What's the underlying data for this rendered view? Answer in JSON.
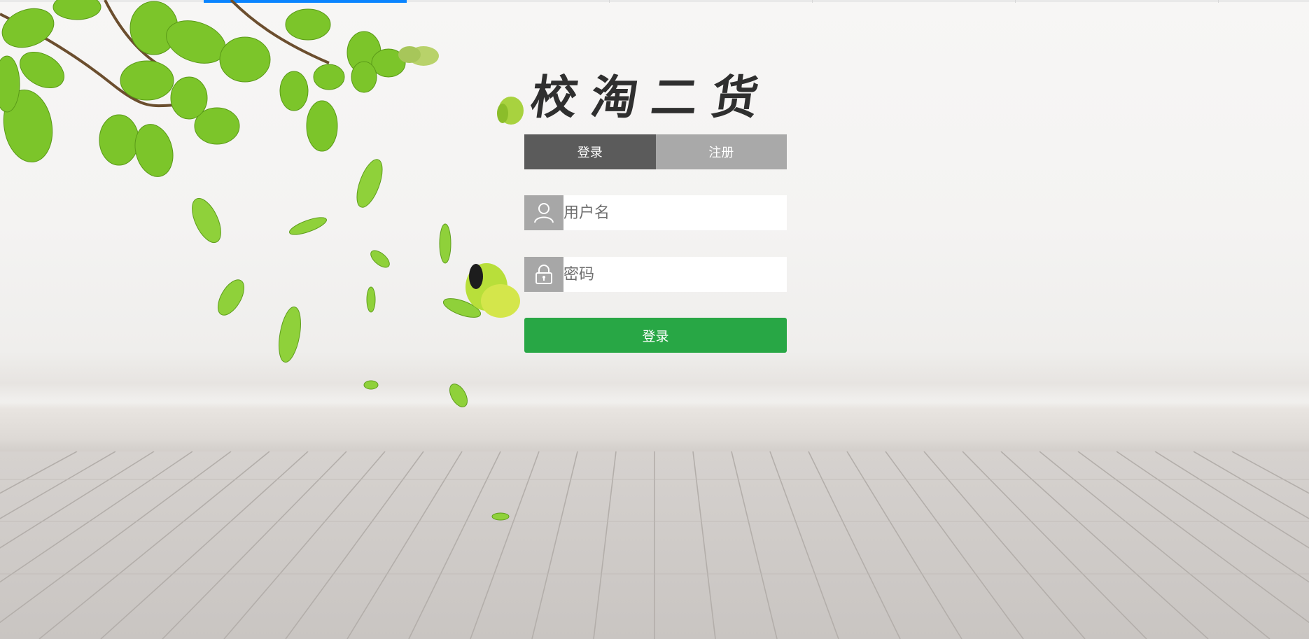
{
  "app": {
    "title": "校淘二货"
  },
  "tabs": [
    {
      "label": "登录",
      "active": true
    },
    {
      "label": "注册",
      "active": false
    }
  ],
  "login_form": {
    "username": {
      "value": "",
      "placeholder": "用户名",
      "icon": "user-icon"
    },
    "password": {
      "value": "",
      "placeholder": "密码",
      "icon": "lock-icon"
    },
    "submit_label": "登录"
  },
  "top_progress": {
    "percent": 13
  },
  "colors": {
    "tab_active": "#5b5b5b",
    "tab_inactive": "#a9a9a9",
    "submit": "#28a745",
    "icon_box": "#a7a7a7",
    "progress": "#0a84ff"
  }
}
